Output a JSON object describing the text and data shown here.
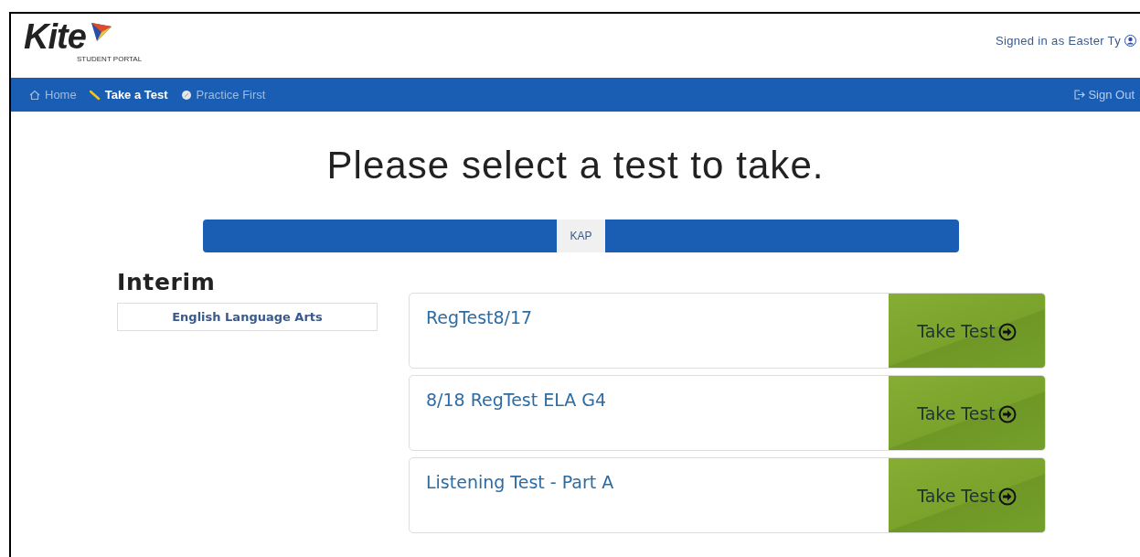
{
  "header": {
    "logo_word": "Kite",
    "logo_subtitle": "STUDENT PORTAL",
    "signed_in": "Signed in as Easter Ty"
  },
  "nav": {
    "items": [
      {
        "label": "Home",
        "kind": "home",
        "selected": false
      },
      {
        "label": "Take a Test",
        "kind": "pencil",
        "selected": true
      },
      {
        "label": "Practice First",
        "kind": "compass",
        "selected": false
      }
    ],
    "sign_out": "Sign Out"
  },
  "heading": "Please select a test to take.",
  "tabs": [
    {
      "label": "KAP",
      "selected": true
    }
  ],
  "section_title": "Interim",
  "subjects": [
    {
      "label": "English Language Arts"
    }
  ],
  "tests": [
    {
      "name": "RegTest8/17",
      "action": "Take Test"
    },
    {
      "name": "8/18 RegTest ELA G4",
      "action": "Take Test"
    },
    {
      "name": "Listening Test - Part A",
      "action": "Take Test"
    }
  ]
}
